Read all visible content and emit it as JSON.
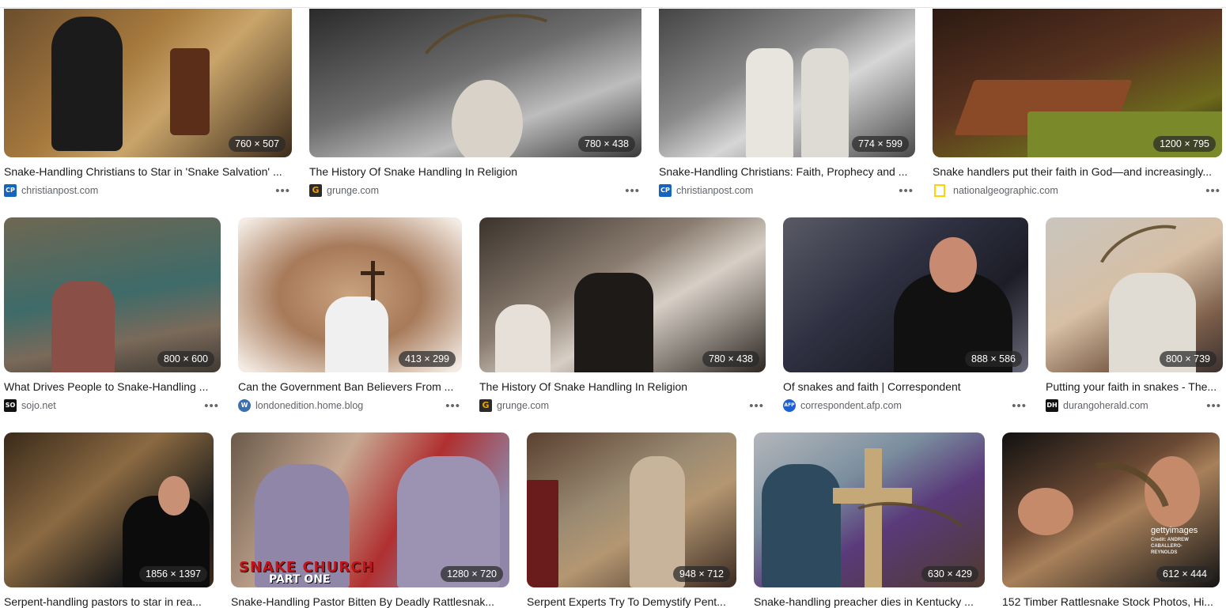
{
  "results": [
    {
      "title": "Snake-Handling Christians to Star in 'Snake Salvation' ...",
      "source": "christianpost.com",
      "dims": "760 × 507",
      "fav": "CP",
      "fav_color": "#1565c0"
    },
    {
      "title": "The History Of Snake Handling In Religion",
      "source": "grunge.com",
      "dims": "780 × 438",
      "fav": "G",
      "fav_color": "#2b2b2b"
    },
    {
      "title": "Snake-Handling Christians: Faith, Prophecy and ...",
      "source": "christianpost.com",
      "dims": "774 × 599",
      "fav": "CP",
      "fav_color": "#1565c0"
    },
    {
      "title": "Snake handlers put their faith in God—and increasingly...",
      "source": "nationalgeographic.com",
      "dims": "1200 × 795",
      "fav": "",
      "fav_color": "#ffd200"
    },
    {
      "title": "What Drives People to Snake-Handling ...",
      "source": "sojo.net",
      "dims": "800 × 600",
      "fav": "SO",
      "fav_color": "#111111"
    },
    {
      "title": "Can the Government Ban Believers From ...",
      "source": "londonedition.home.blog",
      "dims": "413 × 299",
      "fav": "W",
      "fav_color": "#3a6fb0"
    },
    {
      "title": "The History Of Snake Handling In Religion",
      "source": "grunge.com",
      "dims": "780 × 438",
      "fav": "G",
      "fav_color": "#2b2b2b"
    },
    {
      "title": "Of snakes and faith | Correspondent",
      "source": "correspondent.afp.com",
      "dims": "888 × 586",
      "fav": "AFP",
      "fav_color": "#1f5fd1"
    },
    {
      "title": "Putting your faith in snakes - The...",
      "source": "durangoherald.com",
      "dims": "800 × 739",
      "fav": "DH",
      "fav_color": "#111111"
    },
    {
      "title": "Serpent-handling pastors to star in rea...",
      "source": "",
      "dims": "1856 × 1397",
      "fav": "",
      "fav_color": ""
    },
    {
      "title": "Snake-Handling Pastor Bitten By Deadly Rattlesnak...",
      "source": "",
      "dims": "1280 × 720",
      "fav": "",
      "fav_color": "",
      "overlay1": "SNAKE CHURCH",
      "overlay2": "PART ONE"
    },
    {
      "title": "Serpent Experts Try To Demystify Pent...",
      "source": "",
      "dims": "948 × 712",
      "fav": "",
      "fav_color": ""
    },
    {
      "title": "Snake-handling preacher dies in Kentucky ...",
      "source": "",
      "dims": "630 × 429",
      "fav": "",
      "fav_color": ""
    },
    {
      "title": "152 Timber Rattlesnake Stock Photos, Hi...",
      "source": "",
      "dims": "612 × 444",
      "fav": "",
      "fav_color": "",
      "watermark1": "gettyimages",
      "watermark2": "Credit: ANDREW CABALLERO-REYNOLDS"
    }
  ],
  "more_label": "•••"
}
